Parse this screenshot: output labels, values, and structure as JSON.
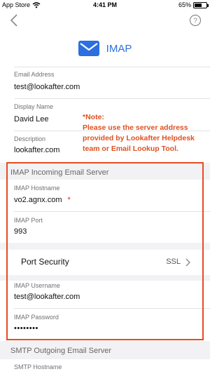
{
  "status_bar": {
    "carrier": "App Store",
    "time": "4:41 PM",
    "battery_text": "65%",
    "battery_level": 0.65
  },
  "header": {
    "title": "IMAP"
  },
  "fields": {
    "email_address": {
      "label": "Email Address",
      "value": "test@lookafter.com"
    },
    "display_name": {
      "label": "Display Name",
      "value": "David Lee"
    },
    "description": {
      "label": "Description",
      "value": "lookafter.com"
    }
  },
  "note": {
    "title": "*Note:",
    "lines": [
      "Please use the server address",
      "provided by Lookafter Helpdesk",
      "team or Email Lookup Tool."
    ]
  },
  "incoming": {
    "section_title": "IMAP Incoming Email Server",
    "hostname": {
      "label": "IMAP Hostname",
      "value": "vo2.agnx.com",
      "required_mark": "*"
    },
    "port": {
      "label": "IMAP Port",
      "value": "993"
    },
    "port_security": {
      "label": "Port Security",
      "value": "SSL"
    },
    "username": {
      "label": "IMAP Username",
      "value": "test@lookafter.com"
    },
    "password": {
      "label": "IMAP Password",
      "value": "••••••••"
    }
  },
  "outgoing": {
    "section_title": "SMTP Outgoing Email Server",
    "hostname": {
      "label": "SMTP Hostname"
    }
  },
  "colors": {
    "accent": "#2b6fe0",
    "note": "#e0501f",
    "highlight_border": "#e84a20",
    "required": "#e62020"
  },
  "icons": [
    "wifi-icon",
    "back-chevron-icon",
    "help-icon",
    "mail-icon",
    "chevron-right-icon"
  ]
}
